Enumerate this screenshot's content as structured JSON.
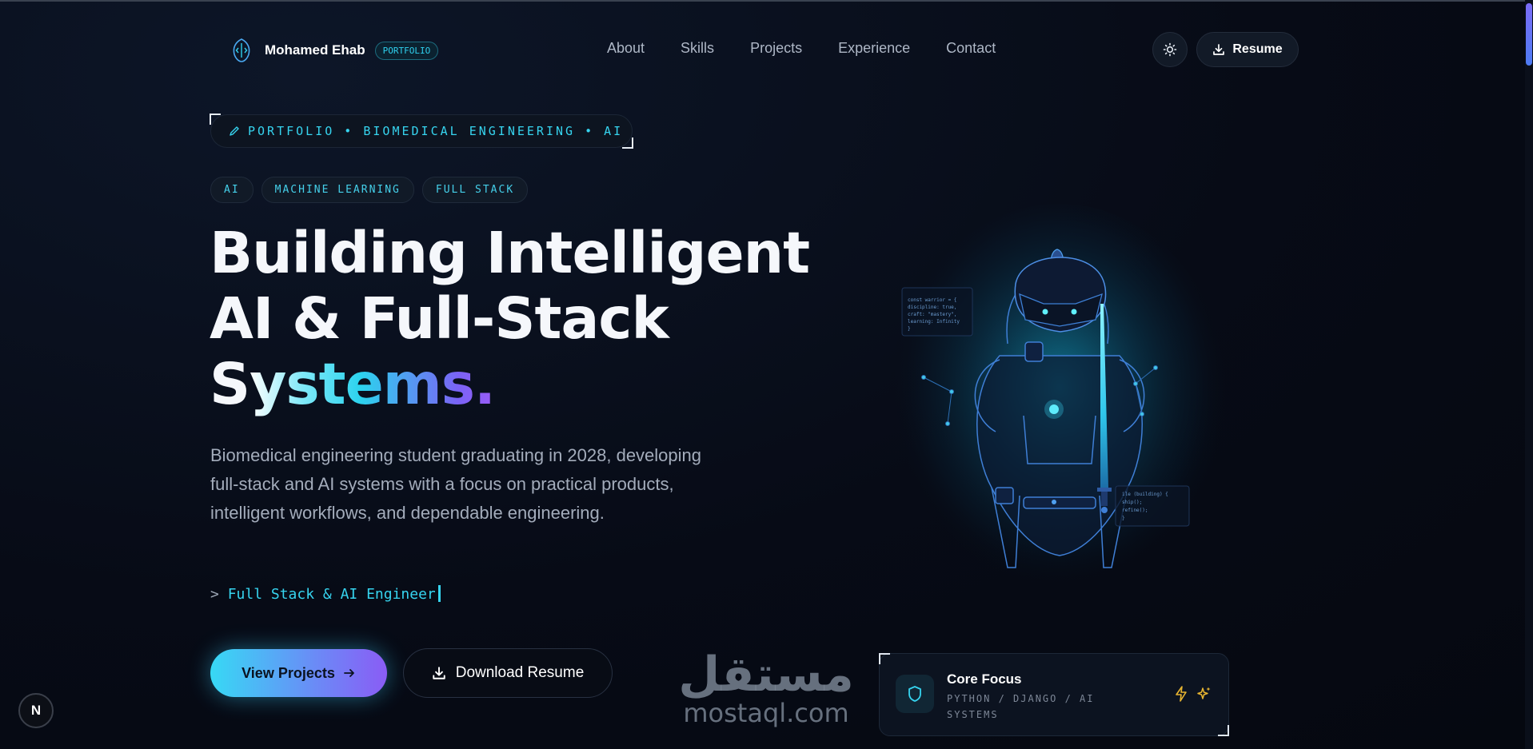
{
  "brand": {
    "name": "Mohamed Ehab",
    "badge": "PORTFOLIO"
  },
  "nav": {
    "links": [
      "About",
      "Skills",
      "Projects",
      "Experience",
      "Contact"
    ],
    "resume_label": "Resume"
  },
  "hero": {
    "label": "PORTFOLIO • BIOMEDICAL ENGINEERING • AI",
    "tags": [
      "AI",
      "MACHINE LEARNING",
      "FULL STACK"
    ],
    "headline_line1": "Building Intelligent",
    "headline_line2": "AI & Full-Stack",
    "headline_line3_plain": "S",
    "headline_line3_grad": "ystems.",
    "description": "Biomedical engineering student graduating in 2028, developing full-stack and AI systems with a focus on practical products, intelligent workflows, and dependable engineering.",
    "typing_prompt": ">",
    "typing_text": "Full Stack & AI Engineer",
    "primary_cta": "View Projects",
    "secondary_cta": "Download Resume"
  },
  "illustration": {
    "code_left": [
      "const warrior = {",
      "  discipline: true,",
      "  craft: \"mastery\",",
      "  learning: Infinity",
      "}"
    ],
    "code_right": [
      "ile (building) {",
      "ship();",
      "refine();",
      "}"
    ]
  },
  "core_focus": {
    "title": "Core Focus",
    "subtitle": "PYTHON / DJANGO / AI SYSTEMS"
  },
  "watermark": {
    "arabic": "مستقل",
    "latin": "mostaql.com"
  },
  "dev_badge": "N",
  "colors": {
    "accent_cyan": "#36d4ef",
    "accent_violet": "#8a5cf5",
    "background": "#070b16"
  }
}
